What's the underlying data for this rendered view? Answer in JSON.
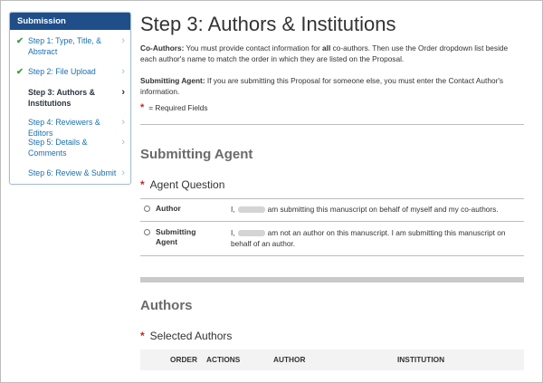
{
  "sidebar": {
    "title": "Submission",
    "steps": [
      {
        "label": "Step 1: Type, Title, & Abstract",
        "completed": true,
        "active": false
      },
      {
        "label": "Step 2: File Upload",
        "completed": true,
        "active": false
      },
      {
        "label": "Step 3: Authors & Institutions",
        "completed": false,
        "active": true
      },
      {
        "label": "Step 4: Reviewers & Editors",
        "completed": false,
        "active": false
      },
      {
        "label": "Step 5: Details & Comments",
        "completed": false,
        "active": false
      },
      {
        "label": "Step 6: Review & Submit",
        "completed": false,
        "active": false
      }
    ]
  },
  "main": {
    "title": "Step 3: Authors & Institutions",
    "coauthors": {
      "label": "Co-Authors:",
      "text_before": " You must provide contact information for ",
      "emphasis": "all",
      "text_after": " co-authors. Then use the Order dropdown list beside each author's name to match the order in which they are listed on the Proposal."
    },
    "submitting_note": {
      "label": "Submitting Agent:",
      "text": " If you are submitting this Proposal for someone else, you must enter the Contact Author's information."
    },
    "required_note": "= Required Fields",
    "submitting_agent_section": "Submitting Agent",
    "agent_question": "Agent Question",
    "options": [
      {
        "label": "Author",
        "prefix": "I,",
        "text": "am submitting this manuscript on behalf of myself and my co-authors."
      },
      {
        "label": "Submitting Agent",
        "prefix": "I,",
        "text": "am not an author on this manuscript. I am submitting this manuscript on behalf of an author."
      }
    ],
    "authors_section": "Authors",
    "selected_authors": "Selected Authors",
    "table_columns": [
      "ORDER",
      "ACTIONS",
      "AUTHOR",
      "INSTITUTION"
    ]
  },
  "colors": {
    "sidebar_header": "#1f4e88",
    "link": "#1a6fb0",
    "check": "#3a9b3a",
    "required": "#c62828"
  }
}
